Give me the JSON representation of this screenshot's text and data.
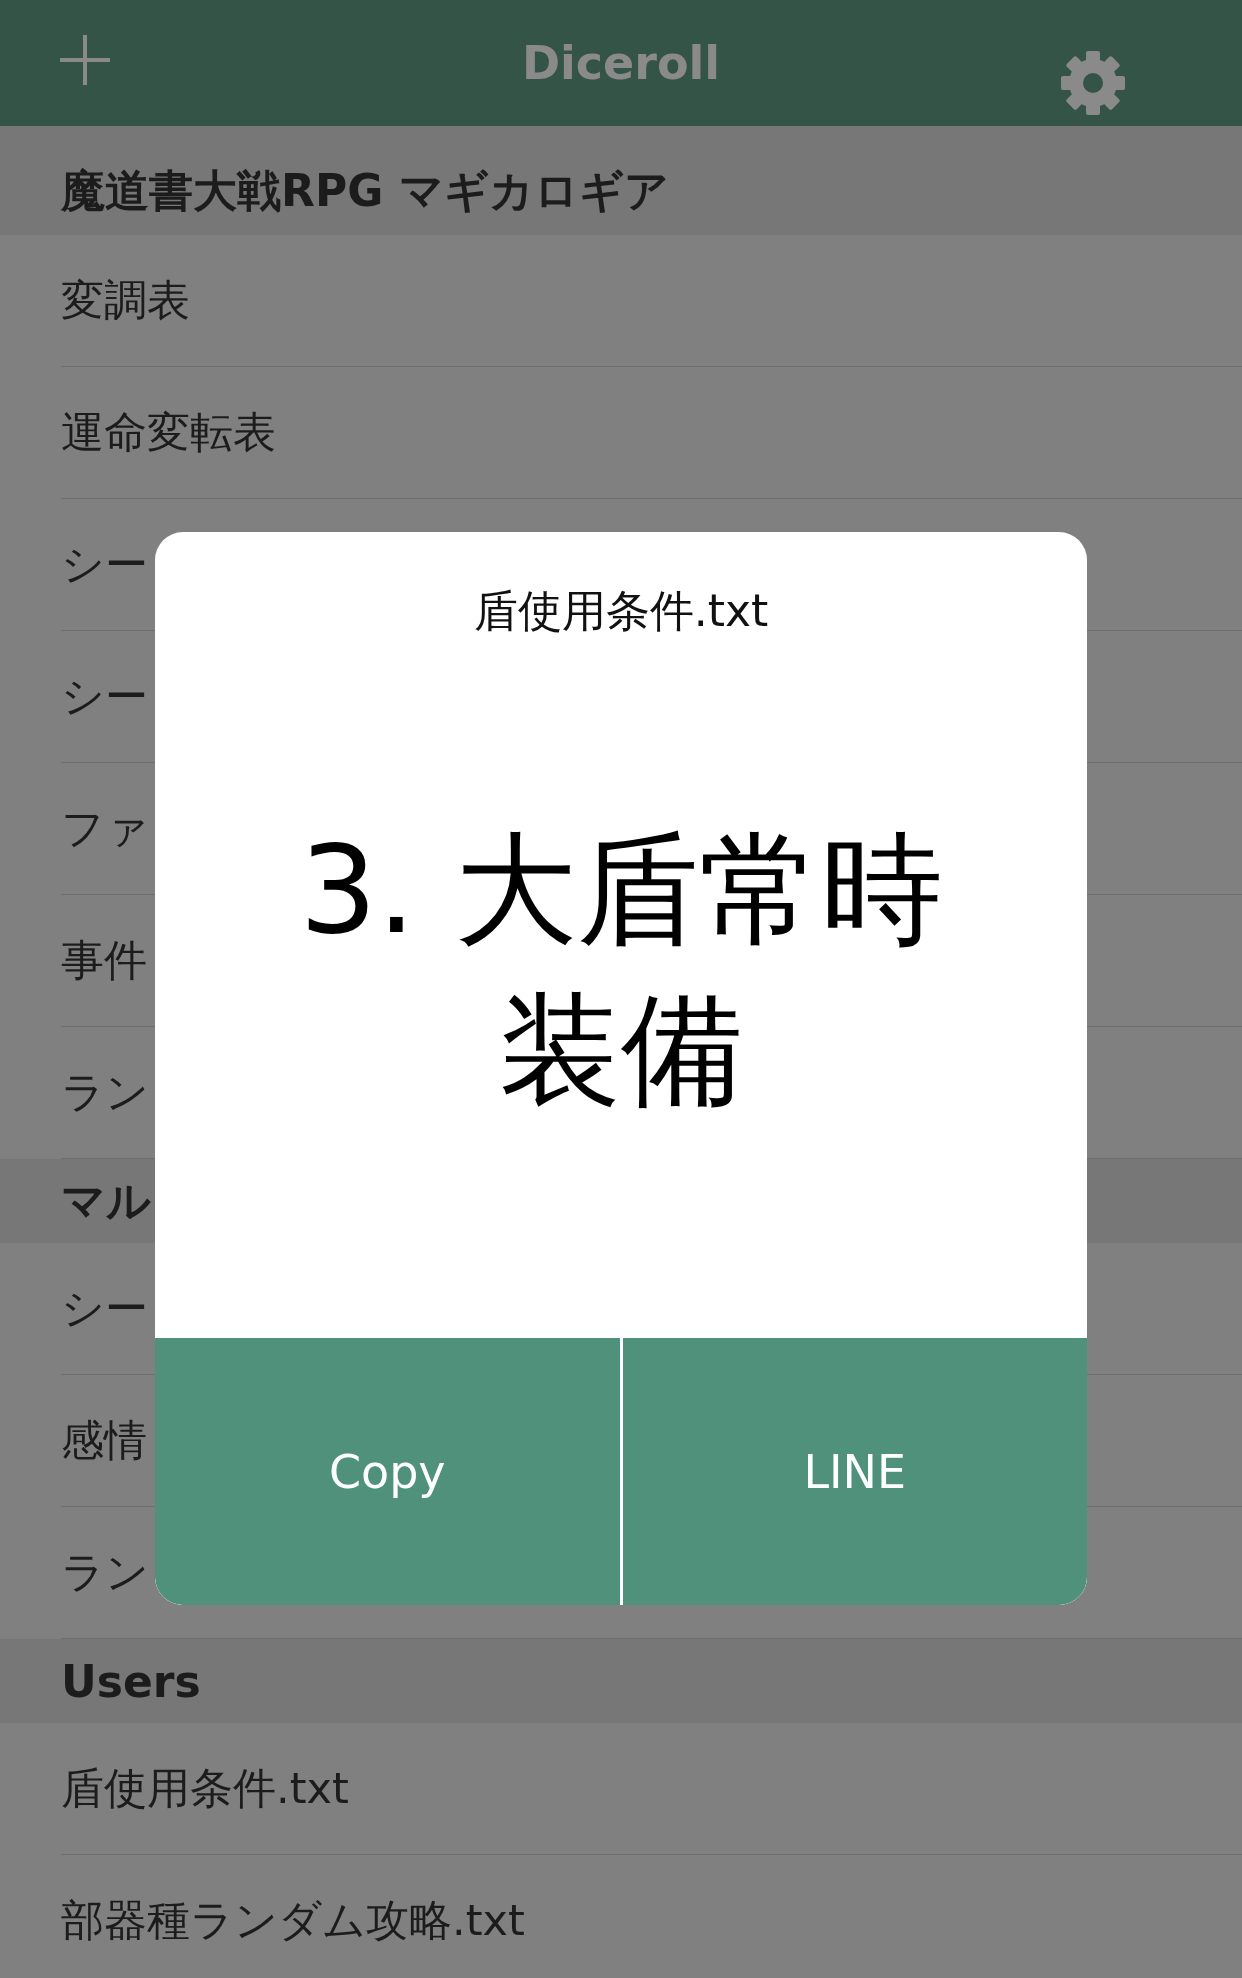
{
  "nav": {
    "title": "Diceroll"
  },
  "sections": [
    {
      "title": "魔道書大戦RPG マギカロギア",
      "rows": [
        "変調表",
        "運命変転表",
        "シー",
        "シー",
        "ファ",
        "事件",
        "ラン"
      ]
    },
    {
      "title": "マル",
      "rows": [
        "シー",
        "感情",
        "ラン"
      ]
    },
    {
      "title": "Users",
      "rows": [
        "盾使用条件.txt",
        "部器種ランダム攻略.txt"
      ]
    }
  ],
  "dialog": {
    "title": "盾使用条件.txt",
    "result": "3. 大盾常時装備",
    "buttons": [
      "Copy",
      "LINE"
    ]
  }
}
